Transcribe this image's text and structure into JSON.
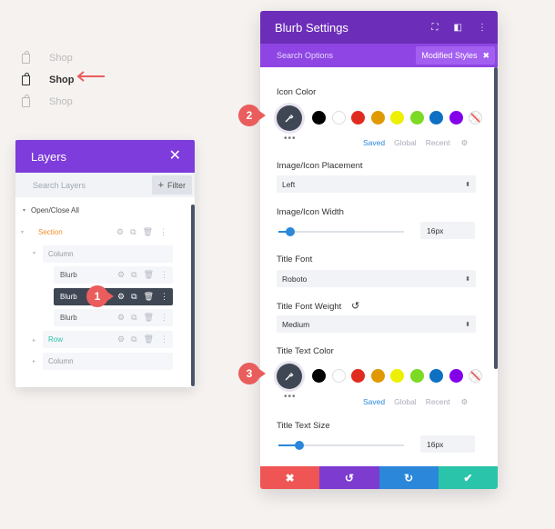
{
  "shop": {
    "items": [
      {
        "label": "Shop",
        "active": false
      },
      {
        "label": "Shop",
        "active": true
      },
      {
        "label": "Shop",
        "active": false
      }
    ]
  },
  "layers": {
    "title": "Layers",
    "close": "✕",
    "search_placeholder": "Search Layers",
    "filter_label": "Filter",
    "filter_icon": "+",
    "open_close_all": "Open/Close All",
    "section": "Section",
    "column1": "Column",
    "blurbs": [
      "Blurb",
      "Blurb",
      "Blurb"
    ],
    "row": "Row",
    "column2": "Column"
  },
  "badges": [
    "1",
    "2",
    "3"
  ],
  "blurb": {
    "title": "Blurb Settings",
    "search_placeholder": "Search Options",
    "modified_label": "Modified Styles",
    "modified_close": "✖",
    "icon_color_label": "Icon Color",
    "placement_label": "Image/Icon Placement",
    "placement_value": "Left",
    "width_label": "Image/Icon Width",
    "width_value": "16px",
    "title_font_label": "Title Font",
    "title_font_value": "Roboto",
    "weight_label": "Title Font Weight",
    "weight_value": "Medium",
    "title_color_label": "Title Text Color",
    "title_size_label": "Title Text Size",
    "title_size_value": "16px",
    "tabs": [
      "Saved",
      "Global",
      "Recent"
    ],
    "dots": "•••"
  },
  "swatches": [
    "#000000",
    "#ffffff",
    "#e02b20",
    "#e09900",
    "#edf000",
    "#7cda24",
    "#0c71c3",
    "#8300e9"
  ],
  "footer_colors": [
    "#ef5555",
    "#7e3bd0",
    "#2b87da",
    "#29c4a9"
  ],
  "footer_icons": [
    "✖",
    "↺",
    "↻",
    "✔"
  ]
}
